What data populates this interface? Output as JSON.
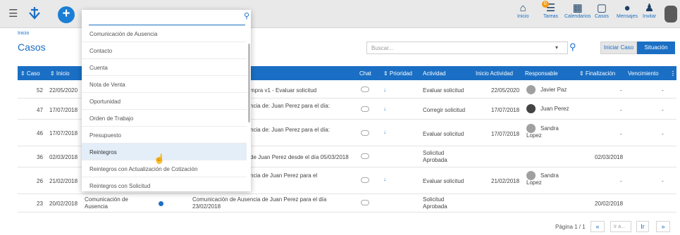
{
  "header": {
    "nav": [
      {
        "label": "Inicio",
        "icon": "home-icon"
      },
      {
        "label": "Tareas",
        "icon": "tasks-icon",
        "badge": "0"
      },
      {
        "label": "Calendarios",
        "icon": "calendar-icon"
      },
      {
        "label": "Casos",
        "icon": "cases-icon"
      },
      {
        "label": "Mensajes",
        "icon": "messages-icon"
      },
      {
        "label": "Invitar",
        "icon": "invite-icon"
      }
    ]
  },
  "breadcrumb": "Inicio",
  "page_title": "Casos",
  "search": {
    "placeholder": "Buscar..."
  },
  "buttons": {
    "iniciar": "Iniciar Caso",
    "situacion": "Situación"
  },
  "table": {
    "columns": [
      "⇕ Caso",
      "⇕ Inicio",
      "Chat",
      "⇕ Prioridad",
      "Actividad",
      "Inicio Actividad",
      "Responsable",
      "⇕ Finalización",
      "Vencimiento"
    ],
    "rows": [
      {
        "caso": "52",
        "inicio": "22/05/2020",
        "desc": "mpra v1 - Evaluar solicitud",
        "actividad": "Evaluar solicitud",
        "inicio_act": "22/05/2020",
        "responsable": "Javier Paz",
        "finalizacion": "-",
        "vencimiento": "-"
      },
      {
        "caso": "47",
        "inicio": "17/07/2018",
        "desc": "ncia de: Juan Perez para el día:",
        "actividad": "Corregir solicitud",
        "inicio_act": "17/07/2018",
        "responsable": "Juan Perez",
        "finalizacion": "-",
        "vencimiento": "-"
      },
      {
        "caso": "46",
        "inicio": "17/07/2018",
        "desc": "ncia de: Juan Perez para el día:",
        "actividad": "Evaluar solicitud",
        "inicio_act": "17/07/2018",
        "responsable": "Sandra Lopez",
        "finalizacion": "-",
        "vencimiento": "-"
      },
      {
        "caso": "36",
        "inicio": "02/03/2018",
        "desc": "de Juan  Perez desde el día 05/03/2018",
        "actividad": "Solicitud Aprobada",
        "inicio_act": "",
        "responsable": "",
        "finalizacion": "02/03/2018",
        "vencimiento": ""
      },
      {
        "caso": "26",
        "inicio": "21/02/2018",
        "desc": "ncia de Juan  Perez para el",
        "actividad": "Evaluar solicitud",
        "inicio_act": "21/02/2018",
        "responsable": "Sandra Lopez",
        "finalizacion": "-",
        "vencimiento": "-"
      },
      {
        "caso": "23",
        "inicio": "20/02/2018",
        "tipo": "Comunicación de Ausencia",
        "desc": "Comunicación de Ausencia de Juan  Perez para el día 23/02/2018",
        "actividad": "Solicitud Aprobada",
        "inicio_act": "",
        "responsable": "",
        "finalizacion": "20/02/2018",
        "vencimiento": ""
      }
    ]
  },
  "dropdown": {
    "search_value": "",
    "items": [
      "Comunicación de Ausencia",
      "Contacto",
      "Cuenta",
      "Nota de Venta",
      "Oportunidad",
      "Orden de Trabajo",
      "Presupuesto",
      "Reintegros",
      "Reintegros con Actualización de Cotización",
      "Reintegros con Solicitud"
    ]
  },
  "pagination": {
    "label": "Página 1 / 1",
    "goto_placeholder": "Ir a...",
    "prev": "«",
    "go": "Ir",
    "next": "»"
  }
}
